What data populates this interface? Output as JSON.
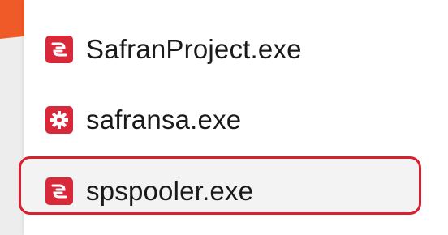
{
  "files": [
    {
      "name": "SafranProject.exe",
      "icon": "safran-logo-icon",
      "highlighted": false
    },
    {
      "name": "safransa.exe",
      "icon": "gear-icon",
      "highlighted": false
    },
    {
      "name": "spspooler.exe",
      "icon": "safran-logo-icon",
      "highlighted": true
    }
  ],
  "colors": {
    "icon_red": "#d9283a",
    "highlight_border": "#d9202f",
    "accent_orange": "#f05a28",
    "background": "#ededed",
    "panel": "#ffffff"
  }
}
